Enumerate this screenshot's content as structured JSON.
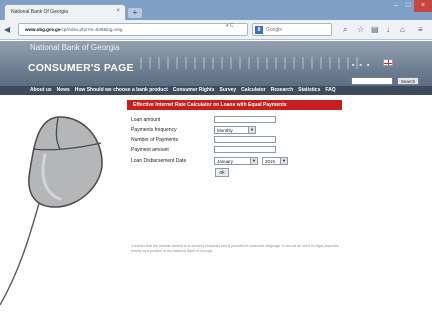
{
  "browser": {
    "tab_title": "National Bank Of Georgia",
    "tab_close": "×",
    "new_tab": "+",
    "window_buttons": [
      "–",
      "□",
      "×"
    ],
    "url_host": "www.nbg.gov.ge",
    "url_path": "/cp/index.php?m=549&lng=eng",
    "search_placeholder": "Google",
    "search_badge": "8"
  },
  "site": {
    "bank_name": "National Bank of Georgia",
    "title": "CONSUMER'S PAGE",
    "search_button": "Search"
  },
  "menu": [
    "About us",
    "News",
    "How Should we choose a bank product",
    "Consumer Rights",
    "Survey",
    "Calculator",
    "Research",
    "Statistics",
    "FAQ"
  ],
  "calculator": {
    "heading": "Effective Internet Rate Calculator on Loans with Equal Payments",
    "labels": {
      "loan_amount": "Loan amount",
      "payments_frequency": "Payments frequency",
      "number_of_payments": "Number of Payments",
      "payment_amount": "Payment amount",
      "disbursement_date": "Loan Disbursement Date"
    },
    "frequency_value": "Monthly",
    "month_value": "January",
    "year_value": "2015",
    "ok_label": "ok"
  },
  "disclaimer": "Consider that the website content is of advisory character and is provided in consumer language. It can not be used for legal purposes hereby as a position of the National Bank of Georgia."
}
